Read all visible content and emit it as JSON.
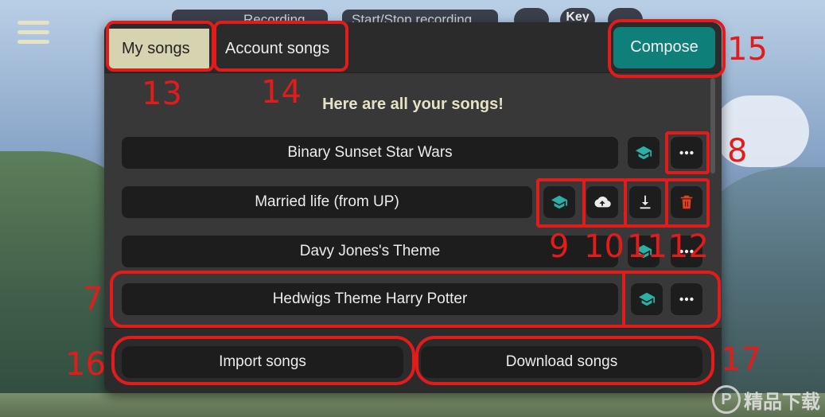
{
  "top_bar": {
    "pill_left": "Recording",
    "pill_right": "Start/Stop recording",
    "key_label": "Key"
  },
  "tabs": [
    {
      "label": "My songs",
      "active": true
    },
    {
      "label": "Account songs",
      "active": false
    }
  ],
  "compose_label": "Compose",
  "heading": "Here are all your songs!",
  "songs": [
    {
      "name": "Binary Sunset Star Wars"
    },
    {
      "name": "Married life (from UP)"
    },
    {
      "name": "Davy Jones's Theme"
    },
    {
      "name": "Hedwigs Theme Harry Potter"
    }
  ],
  "footer": {
    "import_label": "Import songs",
    "download_label": "Download songs"
  },
  "annotations": [
    "7",
    "8",
    "9",
    "10",
    "11",
    "12",
    "13",
    "14",
    "15",
    "16",
    "17"
  ],
  "watermark": {
    "logo": "P",
    "text": "精品下载"
  },
  "colors": {
    "accent": "#0f7f7a",
    "active_tab": "#d6d3b0",
    "annotation": "#e21b1b",
    "learn_icon": "#2bb0a6",
    "delete_icon": "#e0401a"
  },
  "icons": [
    "hamburger-icon",
    "graduation-cap-icon",
    "more-icon",
    "cloud-upload-icon",
    "download-icon",
    "trash-icon"
  ]
}
